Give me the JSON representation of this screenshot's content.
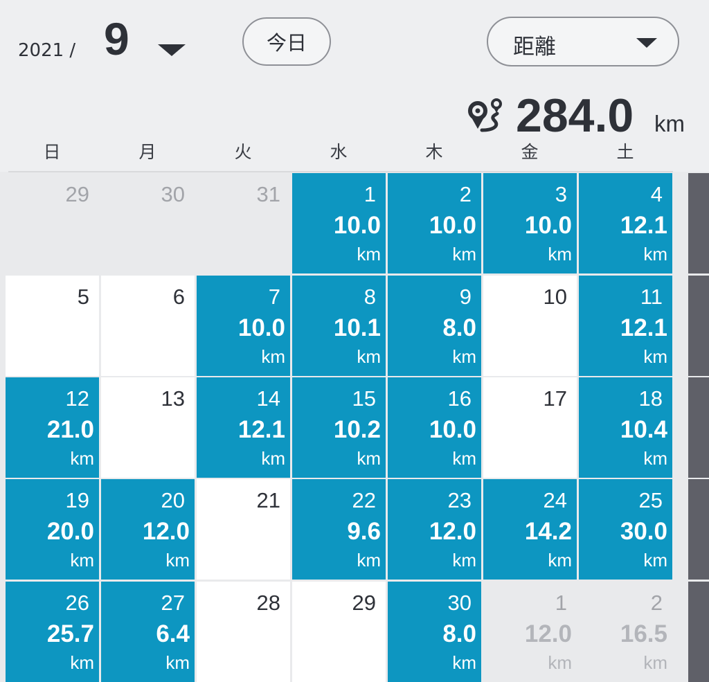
{
  "header": {
    "year_label": "2021 /",
    "month_label": "9",
    "today_button": "今日",
    "metric_selector": "距離",
    "total_value": "284.0",
    "total_unit": "km",
    "icons": {
      "month_dropdown": "caret-down-icon",
      "metric_dropdown": "caret-down-icon",
      "total": "route-pin-icon"
    }
  },
  "weekdays": [
    "日",
    "月",
    "火",
    "水",
    "木",
    "金",
    "土"
  ],
  "colors": {
    "activity_cell": "#0d96c1",
    "empty_cell": "#ffffff",
    "outside_cell": "#e9eaec",
    "text_dark": "#2e3138"
  },
  "weeks": [
    [
      {
        "day": "29",
        "state": "outside"
      },
      {
        "day": "30",
        "state": "outside"
      },
      {
        "day": "31",
        "state": "outside"
      },
      {
        "day": "1",
        "state": "done",
        "distance": "10.0",
        "unit": "km"
      },
      {
        "day": "2",
        "state": "done",
        "distance": "10.0",
        "unit": "km"
      },
      {
        "day": "3",
        "state": "done",
        "distance": "10.0",
        "unit": "km"
      },
      {
        "day": "4",
        "state": "done",
        "distance": "12.1",
        "unit": "km"
      }
    ],
    [
      {
        "day": "5",
        "state": "empty"
      },
      {
        "day": "6",
        "state": "empty"
      },
      {
        "day": "7",
        "state": "done",
        "distance": "10.0",
        "unit": "km"
      },
      {
        "day": "8",
        "state": "done",
        "distance": "10.1",
        "unit": "km"
      },
      {
        "day": "9",
        "state": "done",
        "distance": "8.0",
        "unit": "km"
      },
      {
        "day": "10",
        "state": "empty"
      },
      {
        "day": "11",
        "state": "done",
        "distance": "12.1",
        "unit": "km"
      }
    ],
    [
      {
        "day": "12",
        "state": "done",
        "distance": "21.0",
        "unit": "km"
      },
      {
        "day": "13",
        "state": "empty"
      },
      {
        "day": "14",
        "state": "done",
        "distance": "12.1",
        "unit": "km"
      },
      {
        "day": "15",
        "state": "done",
        "distance": "10.2",
        "unit": "km"
      },
      {
        "day": "16",
        "state": "done",
        "distance": "10.0",
        "unit": "km"
      },
      {
        "day": "17",
        "state": "empty"
      },
      {
        "day": "18",
        "state": "done",
        "distance": "10.4",
        "unit": "km"
      }
    ],
    [
      {
        "day": "19",
        "state": "done",
        "distance": "20.0",
        "unit": "km"
      },
      {
        "day": "20",
        "state": "done",
        "distance": "12.0",
        "unit": "km"
      },
      {
        "day": "21",
        "state": "empty"
      },
      {
        "day": "22",
        "state": "done",
        "distance": "9.6",
        "unit": "km"
      },
      {
        "day": "23",
        "state": "done",
        "distance": "12.0",
        "unit": "km"
      },
      {
        "day": "24",
        "state": "done",
        "distance": "14.2",
        "unit": "km"
      },
      {
        "day": "25",
        "state": "done",
        "distance": "30.0",
        "unit": "km"
      }
    ],
    [
      {
        "day": "26",
        "state": "done",
        "distance": "25.7",
        "unit": "km"
      },
      {
        "day": "27",
        "state": "done",
        "distance": "6.4",
        "unit": "km"
      },
      {
        "day": "28",
        "state": "empty"
      },
      {
        "day": "29",
        "state": "empty"
      },
      {
        "day": "30",
        "state": "done",
        "distance": "8.0",
        "unit": "km"
      },
      {
        "day": "1",
        "state": "outside",
        "distance": "12.0",
        "unit": "km"
      },
      {
        "day": "2",
        "state": "outside",
        "distance": "16.5",
        "unit": "km"
      }
    ]
  ]
}
